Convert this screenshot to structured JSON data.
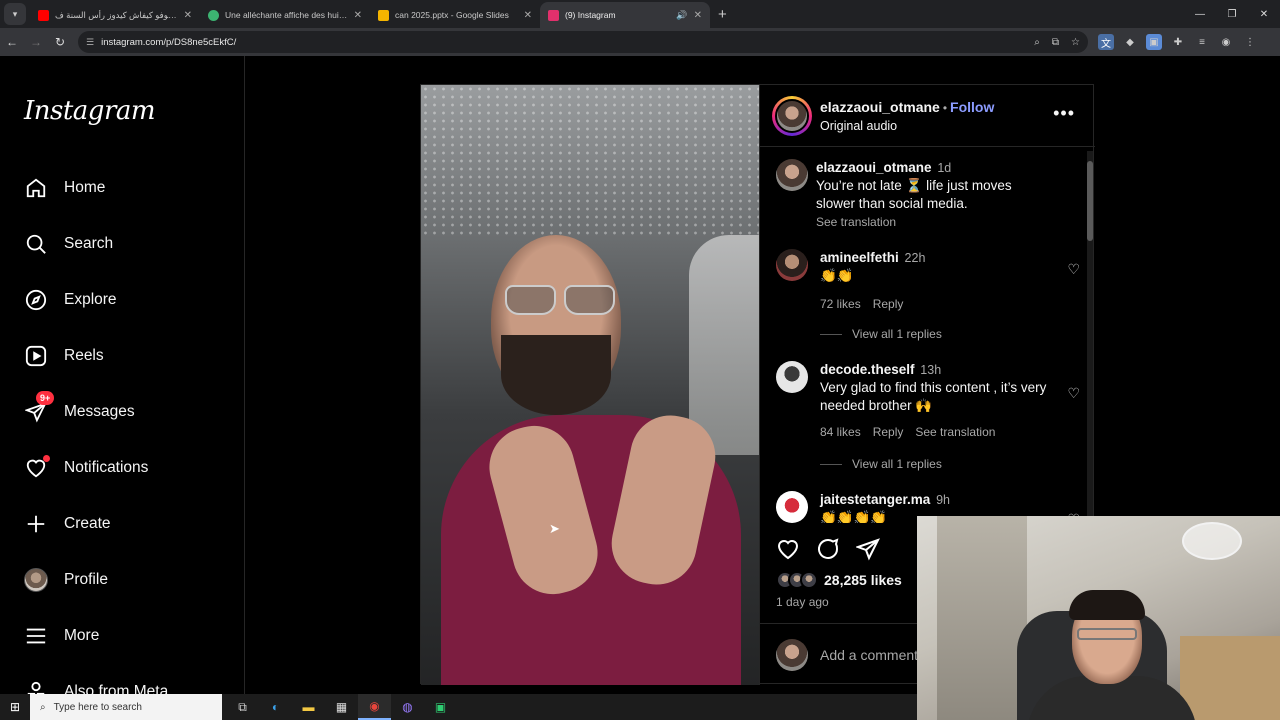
{
  "browser": {
    "tabs": [
      {
        "title": "شوفو كيفاش كيدوز رأس السنة ف...",
        "favicon_color": "#ff0000",
        "active": false
      },
      {
        "title": "Une alléchante affiche des huiti...",
        "favicon_color": "#3cb371",
        "active": false
      },
      {
        "title": "can 2025.pptx - Google Slides",
        "favicon_color": "#f4b400",
        "active": false
      },
      {
        "title": "(9) Instagram",
        "favicon_color": "#e1306c",
        "active": true
      }
    ],
    "url": "instagram.com/p/DS8ne5cEkfC/"
  },
  "instagram": {
    "logo": "Instagram",
    "nav": [
      {
        "label": "Home",
        "icon": "home-icon"
      },
      {
        "label": "Search",
        "icon": "search-icon"
      },
      {
        "label": "Explore",
        "icon": "explore-icon"
      },
      {
        "label": "Reels",
        "icon": "reels-icon"
      },
      {
        "label": "Messages",
        "icon": "messages-icon",
        "badge": "9+"
      },
      {
        "label": "Notifications",
        "icon": "heart-icon"
      },
      {
        "label": "Create",
        "icon": "plus-icon"
      },
      {
        "label": "Profile",
        "icon": "avatar"
      },
      {
        "label": "More",
        "icon": "menu-icon"
      },
      {
        "label": "Also from Meta",
        "icon": "meta-icon"
      }
    ],
    "post": {
      "author": "elazzaoui_otmane",
      "follow_label": "Follow",
      "audio": "Original audio",
      "caption": {
        "user": "elazzaoui_otmane",
        "time": "1d",
        "text": "You’re not late ⏳ life just moves slower than social media.",
        "see_translation": "See translation"
      },
      "comments": [
        {
          "user": "amineelfethi",
          "time": "22h",
          "text": "👏👏",
          "likes": "72 likes",
          "reply": "Reply",
          "view_replies": "View all 1 replies"
        },
        {
          "user": "decode.theself",
          "time": "13h",
          "text": "Very glad to find this content , it’s very needed brother 🙌",
          "likes": "84 likes",
          "reply": "Reply",
          "see_translation": "See translation",
          "view_replies": "View all 1 replies"
        },
        {
          "user": "jaitestetanger.ma",
          "time": "9h",
          "text": "👏👏👏👏"
        }
      ],
      "likes_count": "28,285 likes",
      "posted": "1 day ago",
      "add_comment_placeholder": "Add a comment..."
    }
  },
  "taskbar": {
    "search_placeholder": "Type here to search"
  }
}
